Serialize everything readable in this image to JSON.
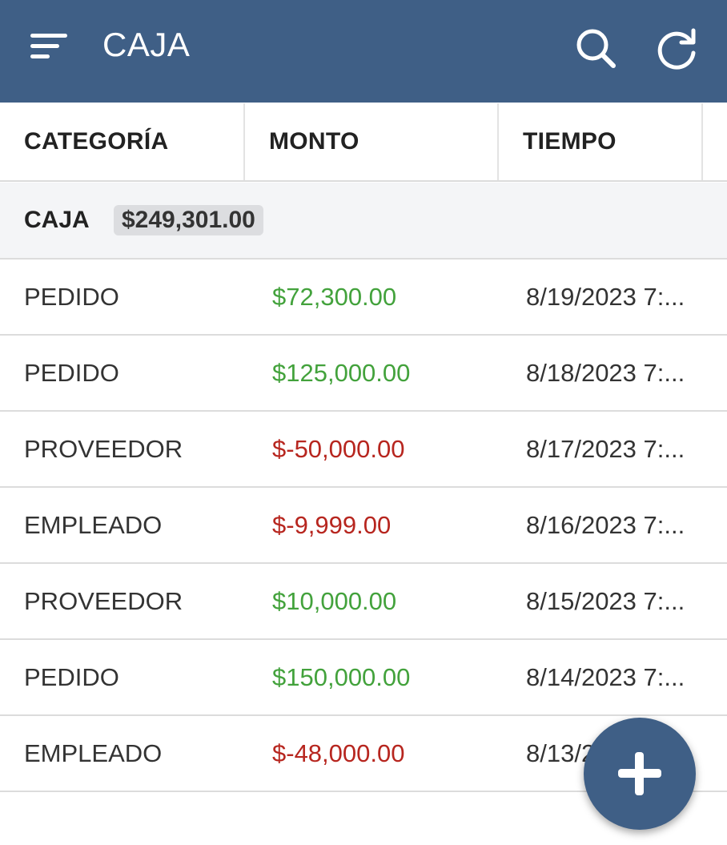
{
  "appbar": {
    "title": "CAJA",
    "icons": [
      "menu-icon",
      "search-icon",
      "refresh-icon"
    ],
    "color": "#3f5f86"
  },
  "columns": [
    "CATEGORÍA",
    "MONTO",
    "TIEMPO"
  ],
  "group": {
    "label": "CAJA",
    "total": "$249,301.00"
  },
  "rows": [
    {
      "category": "PEDIDO",
      "amount": "$72,300.00",
      "sign": "pos",
      "time": "8/19/2023 7:..."
    },
    {
      "category": "PEDIDO",
      "amount": "$125,000.00",
      "sign": "pos",
      "time": "8/18/2023 7:..."
    },
    {
      "category": "PROVEEDOR",
      "amount": "$-50,000.00",
      "sign": "neg",
      "time": "8/17/2023 7:..."
    },
    {
      "category": "EMPLEADO",
      "amount": "$-9,999.00",
      "sign": "neg",
      "time": "8/16/2023 7:..."
    },
    {
      "category": "PROVEEDOR",
      "amount": "$10,000.00",
      "sign": "pos",
      "time": "8/15/2023 7:..."
    },
    {
      "category": "PEDIDO",
      "amount": "$150,000.00",
      "sign": "pos",
      "time": "8/14/2023 7:..."
    },
    {
      "category": "EMPLEADO",
      "amount": "$-48,000.00",
      "sign": "neg",
      "time": "8/13/2023 7:..."
    }
  ],
  "colors": {
    "positive": "#43a23c",
    "negative": "#b7261f"
  },
  "fab_icon": "plus-icon"
}
